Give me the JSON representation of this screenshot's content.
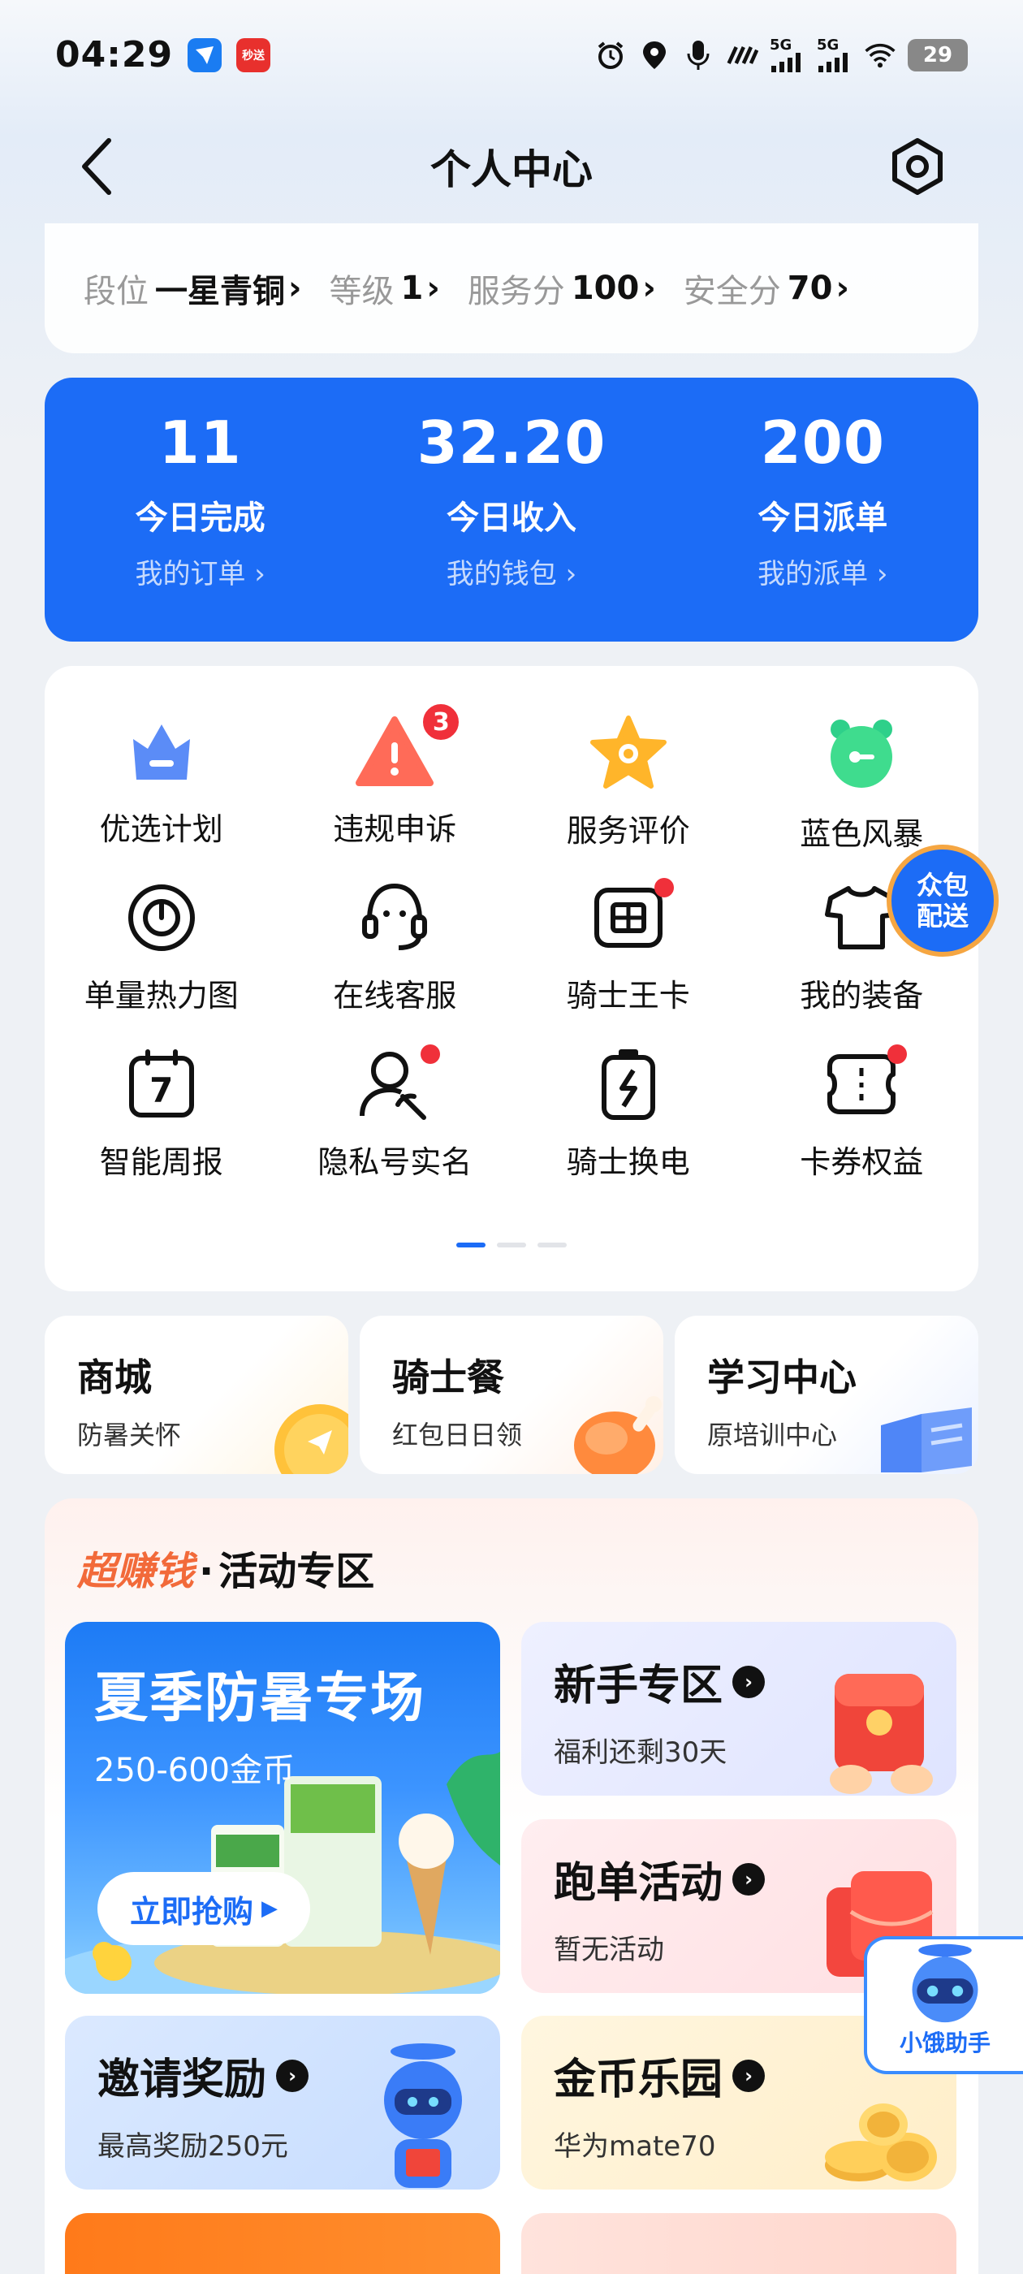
{
  "status_bar": {
    "time": "04:29",
    "app_badge_1": "",
    "app_badge_2": "秒送",
    "signal_1": "5G",
    "signal_2": "5G",
    "battery": "29",
    "icons": [
      "alarm-icon",
      "location-icon",
      "mic-icon",
      "hd-icon",
      "signal-icon",
      "wifi-icon",
      "battery-icon"
    ]
  },
  "header": {
    "title": "个人中心"
  },
  "rank": {
    "items": [
      {
        "label": "段位",
        "value": "一星青铜"
      },
      {
        "label": "等级",
        "value": "1"
      },
      {
        "label": "服务分",
        "value": "100"
      },
      {
        "label": "安全分",
        "value": "70"
      }
    ]
  },
  "stats": [
    {
      "number": "11",
      "label": "今日完成",
      "link": "我的订单"
    },
    {
      "number": "32.20",
      "label": "今日收入",
      "link": "我的钱包"
    },
    {
      "number": "200",
      "label": "今日派单",
      "link": "我的派单"
    }
  ],
  "grid": [
    {
      "label": "优选计划",
      "icon": "crown-icon"
    },
    {
      "label": "违规申诉",
      "icon": "alert-icon",
      "badge": "3"
    },
    {
      "label": "服务评价",
      "icon": "star-icon"
    },
    {
      "label": "蓝色风暴",
      "icon": "alarm-clock-icon"
    },
    {
      "label": "单量热力图",
      "icon": "heatmap-icon"
    },
    {
      "label": "在线客服",
      "icon": "headset-icon"
    },
    {
      "label": "骑士王卡",
      "icon": "sim-card-icon",
      "dot": true
    },
    {
      "label": "我的装备",
      "icon": "tshirt-icon"
    },
    {
      "label": "智能周报",
      "icon": "calendar-icon",
      "calendar_day": "7"
    },
    {
      "label": "隐私号实名",
      "icon": "user-phone-icon",
      "dot": true
    },
    {
      "label": "骑士换电",
      "icon": "battery-swap-icon"
    },
    {
      "label": "卡券权益",
      "icon": "coupon-icon",
      "dot": true
    }
  ],
  "float_crowd": {
    "line1": "众包",
    "line2": "配送"
  },
  "shortcuts": [
    {
      "title": "商城",
      "subtitle": "防暑关怀"
    },
    {
      "title": "骑士餐",
      "subtitle": "红包日日领"
    },
    {
      "title": "学习中心",
      "subtitle": "原培训中心"
    }
  ],
  "activity": {
    "hot": "超赚钱",
    "dot": "·",
    "title": "活动专区",
    "banner": {
      "title": "夏季防暑专场",
      "coins": "250-600金币",
      "cta": "立即抢购"
    },
    "tiles": [
      {
        "title": "新手专区",
        "subtitle": "福利还剩30天"
      },
      {
        "title": "跑单活动",
        "subtitle": "暂无活动"
      },
      {
        "title": "邀请奖励",
        "subtitle": "最高奖励250元"
      },
      {
        "title": "金币乐园",
        "subtitle": "华为mate70"
      }
    ]
  },
  "assistant": {
    "label": "小饿助手"
  },
  "colors": {
    "primary": "#1c6cf6",
    "hot": "#f26a3a",
    "red_dot": "#f0303a"
  }
}
